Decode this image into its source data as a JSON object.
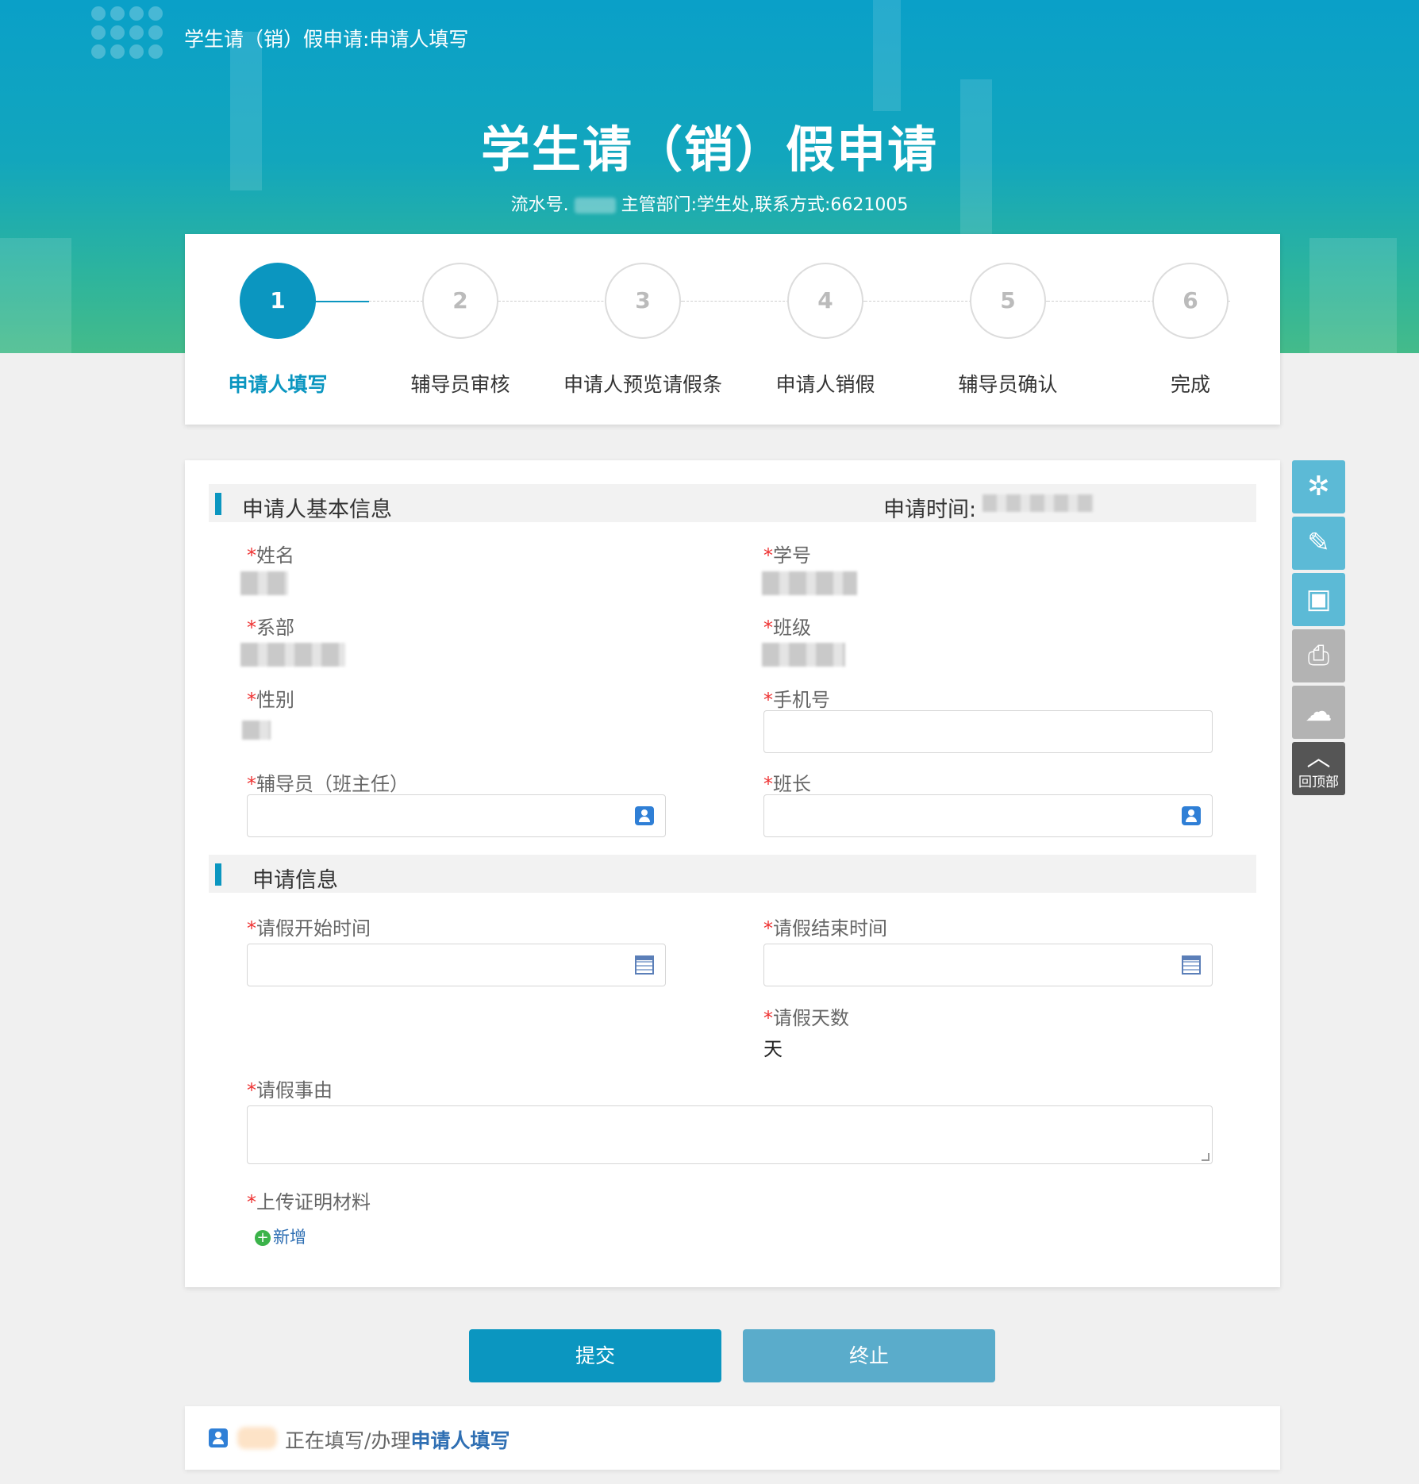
{
  "header": {
    "breadcrumb": "学生请（销）假申请:申请人填写",
    "title": "学生请（销）假申请",
    "serial_prefix": "流水号.",
    "serial_suffix": "主管部门:学生处,联系方式:6621005"
  },
  "steps": [
    {
      "num": "1",
      "label": "申请人填写",
      "active": true
    },
    {
      "num": "2",
      "label": "辅导员审核"
    },
    {
      "num": "3",
      "label": "申请人预览请假条"
    },
    {
      "num": "4",
      "label": "申请人销假"
    },
    {
      "num": "5",
      "label": "辅导员确认"
    },
    {
      "num": "6",
      "label": "完成"
    }
  ],
  "section_basic": {
    "title": "申请人基本信息",
    "time_label": "申请时间:"
  },
  "fields": {
    "name": "姓名",
    "student_id": "学号",
    "department": "系部",
    "class": "班级",
    "gender": "性别",
    "phone": "手机号",
    "counselor": "辅导员（班主任）",
    "monitor": "班长"
  },
  "section_apply": {
    "title": "申请信息",
    "start_time": "请假开始时间",
    "end_time": "请假结束时间",
    "days": "请假天数",
    "days_unit": "天",
    "reason": "请假事由",
    "upload": "上传证明材料",
    "add": "新增"
  },
  "required_mark": "*",
  "toolbar": {
    "back_top": "回顶部"
  },
  "buttons": {
    "submit": "提交",
    "stop": "终止"
  },
  "status": {
    "prefix": "正在填写/办理",
    "step": "申请人填写"
  },
  "colors": {
    "accent": "#0b96c0",
    "required": "#ee3333"
  }
}
